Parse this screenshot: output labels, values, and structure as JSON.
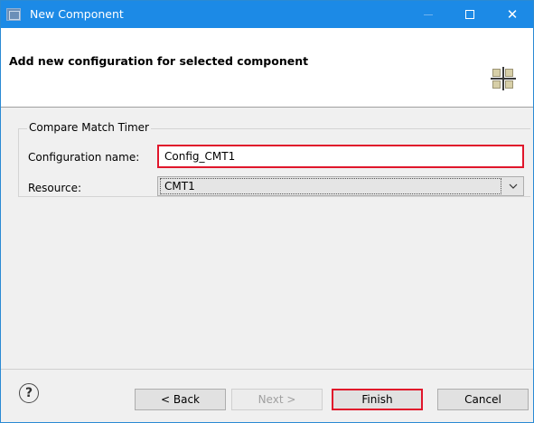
{
  "window": {
    "title": "New Component"
  },
  "header": {
    "title": "Add new configuration for selected component"
  },
  "group": {
    "legend": "Compare Match Timer",
    "name_label": "Configuration name:",
    "name_value": "Config_CMT1",
    "resource_label": "Resource:",
    "resource_value": "CMT1"
  },
  "footer": {
    "help_glyph": "?",
    "back_label": "< Back",
    "next_label": "Next >",
    "finish_label": "Finish",
    "cancel_label": "Cancel"
  },
  "colors": {
    "titlebar": "#1c8ae6",
    "highlight": "#e0162b"
  }
}
